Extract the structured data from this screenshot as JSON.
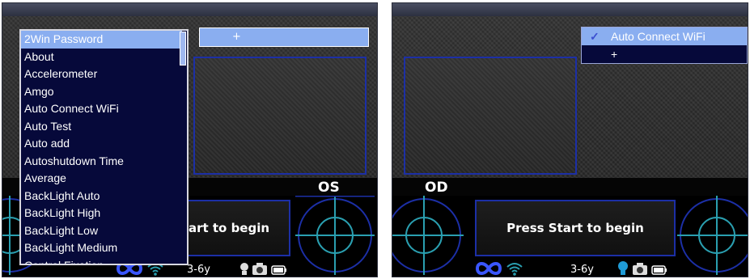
{
  "left_screen": {
    "eye_label": "OS",
    "add_button_label": "+",
    "prompt_text": "art to begin",
    "age_text": "3-6y",
    "settings_list": [
      "2Win Password",
      "About",
      "Accelerometer",
      "Amgo",
      "Auto Connect WiFi",
      "Auto Test",
      "Auto add",
      "Autoshutdown Time",
      "Average",
      "BackLight Auto",
      "BackLight High",
      "BackLight Low",
      "BackLight Medium",
      "Control Fixation"
    ],
    "selected_index": 0
  },
  "right_screen": {
    "eye_label": "OD",
    "prompt_text": "Press Start to begin",
    "age_text": "3-6y",
    "dropdown": {
      "items": [
        "Auto Connect WiFi",
        "+"
      ],
      "selected_index": 0,
      "check_symbol": "✓"
    }
  },
  "colors": {
    "accent_blue": "#1c2fa6",
    "target_line": "#2a9fb0",
    "selection": "#8aaef0",
    "list_bg": "#06093a"
  }
}
